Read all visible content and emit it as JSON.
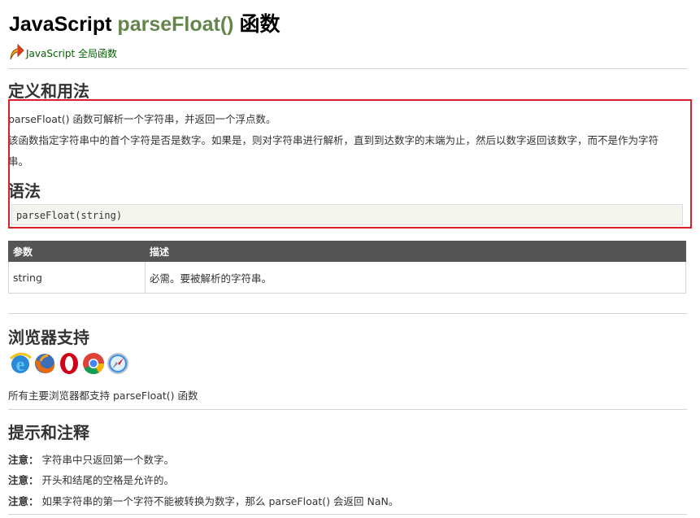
{
  "header": {
    "title_prefix": "JavaScript ",
    "title_fn": "parseFloat()",
    "title_suffix": " 函数",
    "backlink": "JavaScript 全局函数"
  },
  "definition": {
    "heading": "定义和用法",
    "para1": "parseFloat() 函数可解析一个字符串，并返回一个浮点数。",
    "para2a": "该函数指定字符串中的首个字符是否是数字。如果是，则对字符串进行解析，直到到达数字的末端为止，然后以数字返回该数字，而不是作为字符",
    "para2b": "串。"
  },
  "syntax": {
    "heading": "语法",
    "code": "parseFloat(string)"
  },
  "params": {
    "headers": [
      "参数",
      "描述"
    ],
    "rows": [
      {
        "name": "string",
        "desc": "必需。要被解析的字符串。"
      }
    ]
  },
  "support": {
    "heading": "浏览器支持",
    "icons": [
      "ie-icon",
      "firefox-icon",
      "opera-icon",
      "chrome-icon",
      "safari-icon"
    ],
    "text": "所有主要浏览器都支持 parseFloat() 函数"
  },
  "tips": {
    "heading": "提示和注释",
    "label": "注意：",
    "notes": [
      "字符串中只返回第一个数字。",
      "开头和结尾的空格是允许的。",
      "如果字符串的第一个字符不能被转换为数字，那么 parseFloat() 会返回 NaN。"
    ]
  },
  "colors": {
    "accent_green": "#64854c",
    "link_green": "#006400",
    "highlight_red": "#d9202a",
    "table_header": "#555555"
  }
}
